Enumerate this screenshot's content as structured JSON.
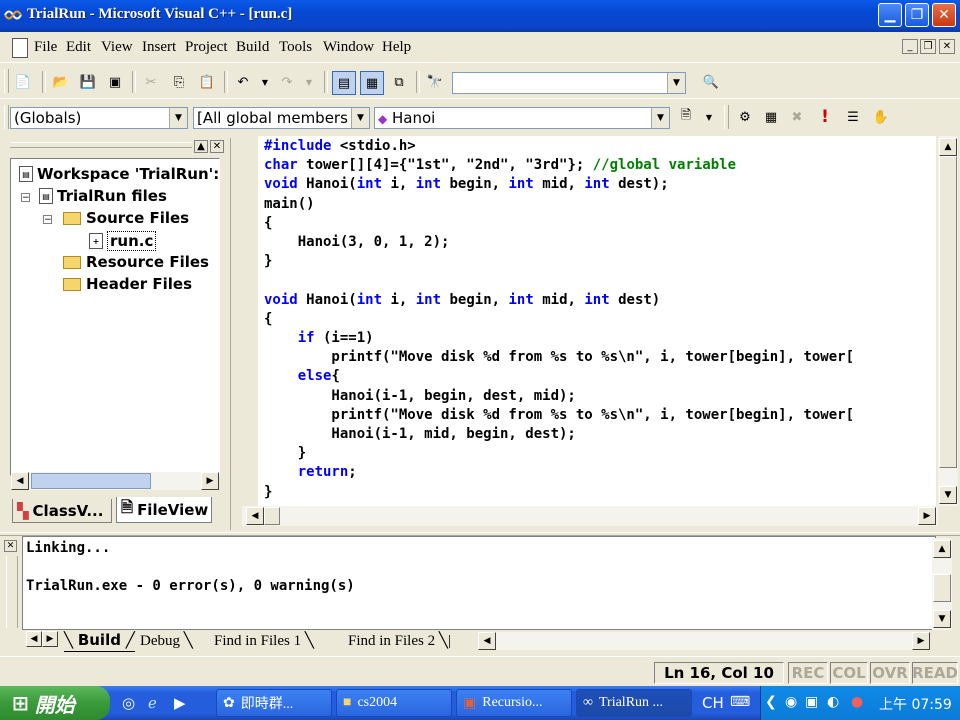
{
  "window": {
    "title": "TrialRun - Microsoft Visual C++ - [run.c]"
  },
  "menu": [
    "File",
    "Edit",
    "View",
    "Insert",
    "Project",
    "Build",
    "Tools",
    "Window",
    "Help"
  ],
  "toolbar": {
    "scope_combo": "(Globals)",
    "members_combo": "[All global members",
    "function_combo": "Hanoi",
    "find_combo": ""
  },
  "workspace": {
    "root": "Workspace 'TrialRun':",
    "project": "TrialRun files",
    "folders": [
      "Source Files",
      "Resource Files",
      "Header Files"
    ],
    "file": "run.c",
    "tabs": [
      "ClassV...",
      "FileView"
    ]
  },
  "editor": {
    "lines": [
      [
        [
          "kw",
          "#include"
        ],
        [
          "t",
          " <stdio.h>"
        ]
      ],
      [
        [
          "kw",
          "char"
        ],
        [
          "t",
          " tower[][4]={\"1st\", \"2nd\", \"3rd\"}; "
        ],
        [
          "cm",
          "//global variable"
        ]
      ],
      [
        [
          "kw",
          "void"
        ],
        [
          "t",
          " Hanoi("
        ],
        [
          "kw",
          "int"
        ],
        [
          "t",
          " i, "
        ],
        [
          "kw",
          "int"
        ],
        [
          "t",
          " begin, "
        ],
        [
          "kw",
          "int"
        ],
        [
          "t",
          " mid, "
        ],
        [
          "kw",
          "int"
        ],
        [
          "t",
          " dest);"
        ]
      ],
      [
        [
          "t",
          "main()"
        ]
      ],
      [
        [
          "t",
          "{"
        ]
      ],
      [
        [
          "t",
          "    Hanoi(3, 0, 1, 2);"
        ]
      ],
      [
        [
          "t",
          "}"
        ]
      ],
      [
        [
          "t",
          ""
        ]
      ],
      [
        [
          "kw",
          "void"
        ],
        [
          "t",
          " Hanoi("
        ],
        [
          "kw",
          "int"
        ],
        [
          "t",
          " i, "
        ],
        [
          "kw",
          "int"
        ],
        [
          "t",
          " begin, "
        ],
        [
          "kw",
          "int"
        ],
        [
          "t",
          " mid, "
        ],
        [
          "kw",
          "int"
        ],
        [
          "t",
          " dest)"
        ]
      ],
      [
        [
          "t",
          "{"
        ]
      ],
      [
        [
          "t",
          "    "
        ],
        [
          "kw",
          "if"
        ],
        [
          "t",
          " (i==1)"
        ]
      ],
      [
        [
          "t",
          "        printf(\"Move disk %d from %s to %s\\n\", i, tower[begin], tower["
        ]
      ],
      [
        [
          "t",
          "    "
        ],
        [
          "kw",
          "else"
        ],
        [
          "t",
          "{"
        ]
      ],
      [
        [
          "t",
          "        Hanoi(i-1, begin, dest, mid);"
        ]
      ],
      [
        [
          "t",
          "        printf(\"Move disk %d from %s to %s\\n\", i, tower[begin], tower["
        ]
      ],
      [
        [
          "t",
          "        Hanoi(i-1, mid, begin, dest);"
        ]
      ],
      [
        [
          "t",
          "    }"
        ]
      ],
      [
        [
          "t",
          "    "
        ],
        [
          "kw",
          "return"
        ],
        [
          "t",
          ";"
        ]
      ],
      [
        [
          "t",
          "}"
        ]
      ]
    ]
  },
  "output": {
    "lines": [
      "Linking...",
      "",
      "TrialRun.exe - 0 error(s), 0 warning(s)"
    ],
    "tabs": [
      "Build",
      "Debug",
      "Find in Files 1",
      "Find in Files 2"
    ]
  },
  "status": {
    "position": "Ln 16, Col 10",
    "rec": "REC",
    "col": "COL",
    "ovr": "OVR",
    "read": "READ"
  },
  "taskbar": {
    "start": "開始",
    "tasks": [
      "即時群...",
      "cs2004",
      "Recursio...",
      "TrialRun ..."
    ],
    "lang": "CH",
    "clock": "上午 07:59"
  },
  "colors": {
    "keyword": "#0000ff",
    "comment": "#008000",
    "titlebar": "#0548d4"
  }
}
